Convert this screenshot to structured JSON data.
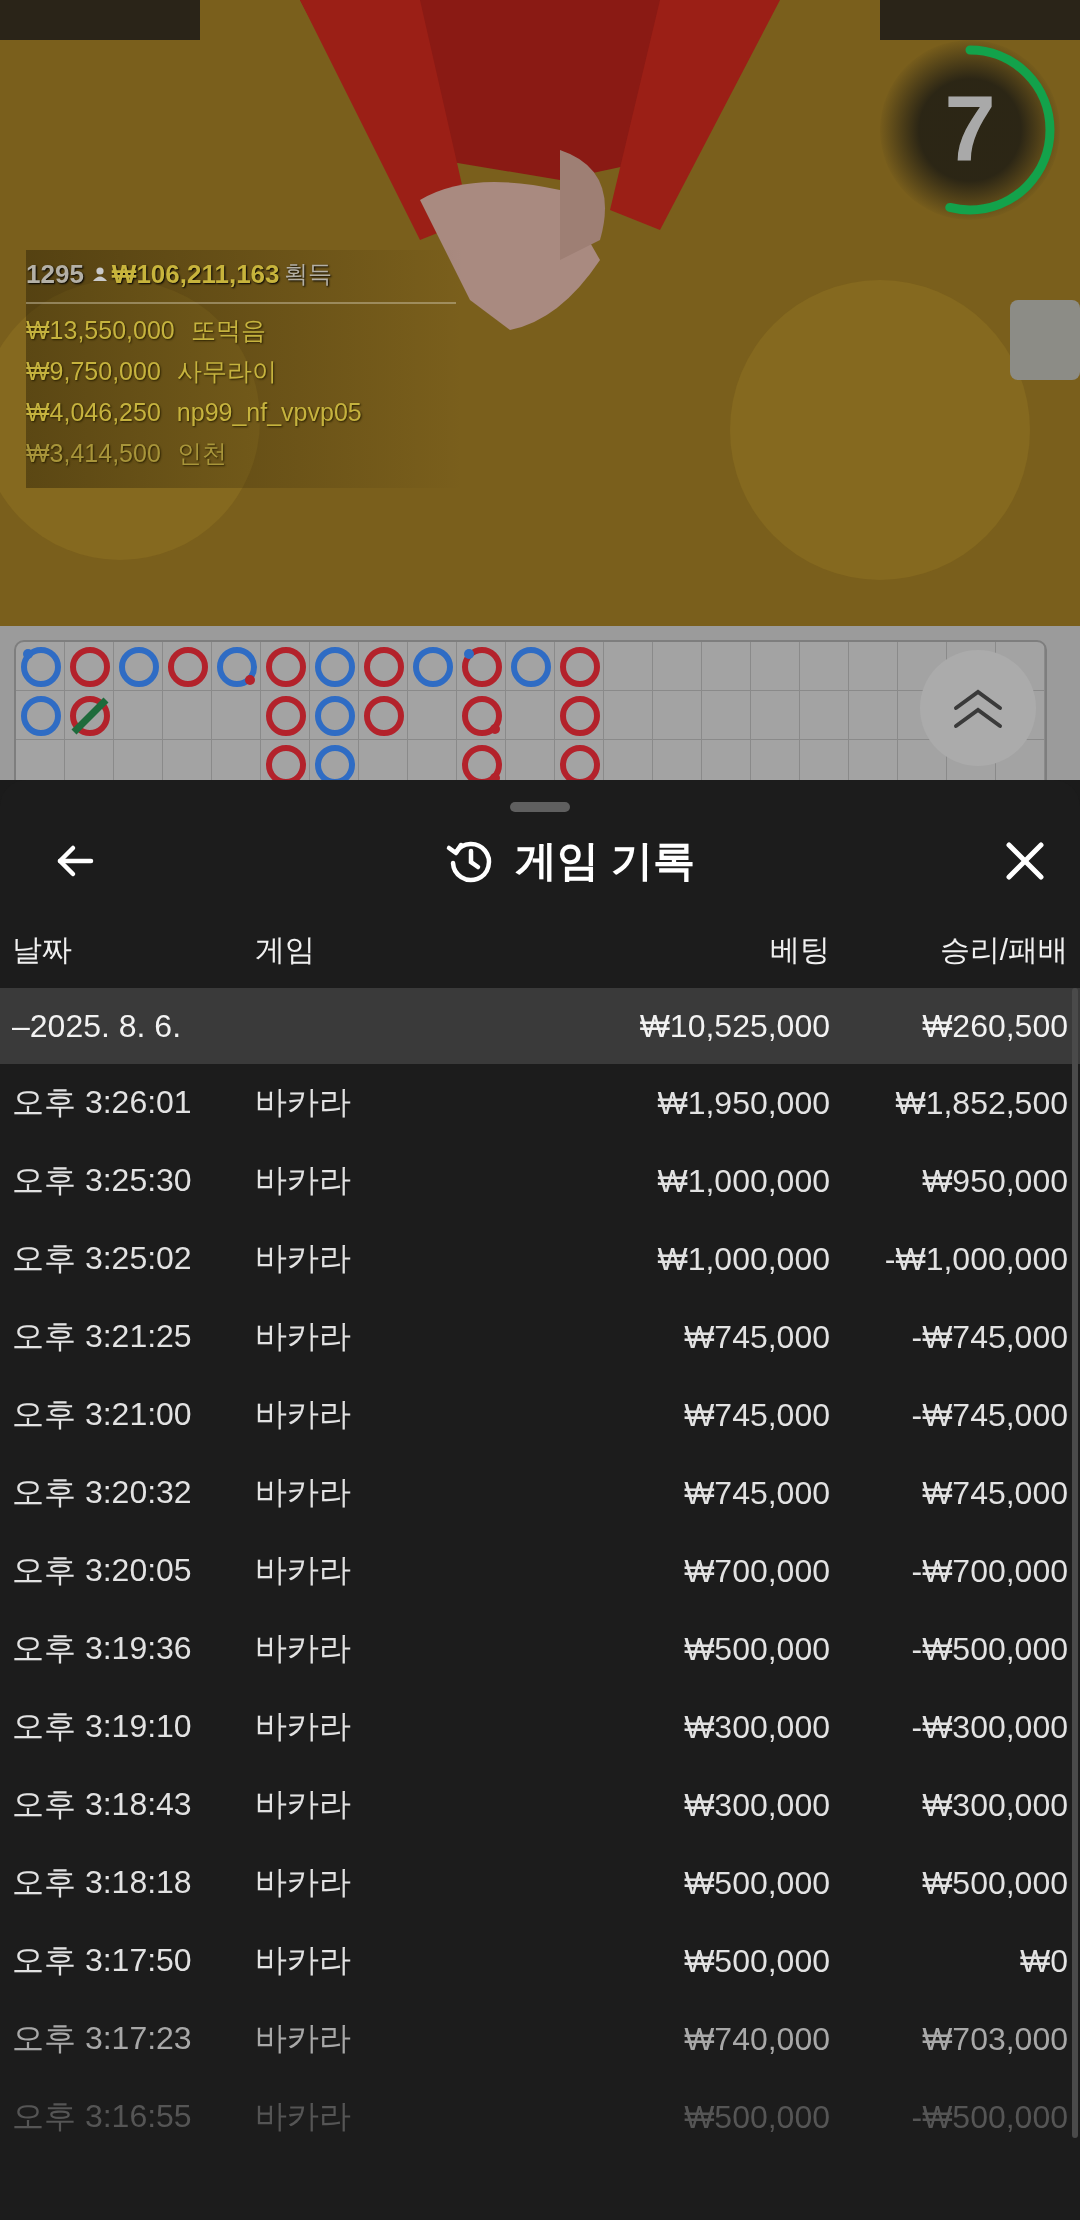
{
  "video": {
    "kind": "picture",
    "timer": {
      "count": "7",
      "level": 0.54
    },
    "stats": {
      "players": "1295",
      "total": "₩106,211,163",
      "total_label": "획득",
      "leaders": [
        {
          "amount": "₩13,550,000",
          "name": "또먹음"
        },
        {
          "amount": "₩9,750,000",
          "name": "사무라이"
        },
        {
          "amount": "₩4,046,250",
          "name": "np99_nf_vpvp05"
        },
        {
          "amount": "₩3,414,500",
          "name": "인천"
        }
      ]
    }
  },
  "roadmap": {
    "columns": [
      [
        {
          "color": "#2f6cc4",
          "player_pair": true,
          "banker_pair": false,
          "tie": false
        },
        {
          "color": "#2f6cc4",
          "player_pair": false,
          "banker_pair": false,
          "tie": false
        }
      ],
      [
        {
          "color": "#b3222b",
          "player_pair": false,
          "banker_pair": false,
          "tie": false
        },
        {
          "color": "#b3222b",
          "player_pair": false,
          "banker_pair": false,
          "tie": true
        }
      ],
      [
        {
          "color": "#2f6cc4",
          "player_pair": false,
          "banker_pair": false,
          "tie": false
        }
      ],
      [
        {
          "color": "#b3222b",
          "player_pair": false,
          "banker_pair": false,
          "tie": false
        }
      ],
      [
        {
          "color": "#2f6cc4",
          "player_pair": false,
          "banker_pair": true,
          "tie": false
        }
      ],
      [
        {
          "color": "#b3222b",
          "player_pair": false,
          "banker_pair": false,
          "tie": false
        },
        {
          "color": "#b3222b",
          "player_pair": false,
          "banker_pair": false,
          "tie": false
        },
        {
          "color": "#b3222b",
          "player_pair": false,
          "banker_pair": false,
          "tie": false
        }
      ],
      [
        {
          "color": "#2f6cc4",
          "player_pair": false,
          "banker_pair": false,
          "tie": false
        },
        {
          "color": "#2f6cc4",
          "player_pair": false,
          "banker_pair": false,
          "tie": false
        },
        {
          "color": "#2f6cc4",
          "player_pair": false,
          "banker_pair": false,
          "tie": false
        }
      ],
      [
        {
          "color": "#b3222b",
          "player_pair": false,
          "banker_pair": false,
          "tie": false
        },
        {
          "color": "#b3222b",
          "player_pair": false,
          "banker_pair": false,
          "tie": false
        }
      ],
      [
        {
          "color": "#2f6cc4",
          "player_pair": false,
          "banker_pair": false,
          "tie": false
        }
      ],
      [
        {
          "color": "#b3222b",
          "player_pair": true,
          "banker_pair": false,
          "tie": false
        },
        {
          "color": "#b3222b",
          "player_pair": false,
          "banker_pair": true,
          "tie": false
        },
        {
          "color": "#b3222b",
          "player_pair": false,
          "banker_pair": true,
          "tie": false
        }
      ],
      [
        {
          "color": "#2f6cc4",
          "player_pair": false,
          "banker_pair": false,
          "tie": false
        }
      ],
      [
        {
          "color": "#b3222b",
          "player_pair": false,
          "banker_pair": false,
          "tie": false
        },
        {
          "color": "#b3222b",
          "player_pair": false,
          "banker_pair": false,
          "tie": false
        },
        {
          "color": "#b3222b",
          "player_pair": false,
          "banker_pair": false,
          "tie": false
        }
      ]
    ]
  },
  "sheet": {
    "title": "게임 기록",
    "table": {
      "columns": [
        "날짜",
        "게임",
        "베팅",
        "승리/패배"
      ],
      "summary": {
        "date": "–2025. 8. 6.",
        "bet": "₩10,525,000",
        "result": "₩260,500"
      },
      "rows": [
        {
          "time": "오후 3:26:01",
          "game": "바카라",
          "bet": "₩1,950,000",
          "result": "₩1,852,500"
        },
        {
          "time": "오후 3:25:30",
          "game": "바카라",
          "bet": "₩1,000,000",
          "result": "₩950,000"
        },
        {
          "time": "오후 3:25:02",
          "game": "바카라",
          "bet": "₩1,000,000",
          "result": "-₩1,000,000"
        },
        {
          "time": "오후 3:21:25",
          "game": "바카라",
          "bet": "₩745,000",
          "result": "-₩745,000"
        },
        {
          "time": "오후 3:21:00",
          "game": "바카라",
          "bet": "₩745,000",
          "result": "-₩745,000"
        },
        {
          "time": "오후 3:20:32",
          "game": "바카라",
          "bet": "₩745,000",
          "result": "₩745,000"
        },
        {
          "time": "오후 3:20:05",
          "game": "바카라",
          "bet": "₩700,000",
          "result": "-₩700,000"
        },
        {
          "time": "오후 3:19:36",
          "game": "바카라",
          "bet": "₩500,000",
          "result": "-₩500,000"
        },
        {
          "time": "오후 3:19:10",
          "game": "바카라",
          "bet": "₩300,000",
          "result": "-₩300,000"
        },
        {
          "time": "오후 3:18:43",
          "game": "바카라",
          "bet": "₩300,000",
          "result": "₩300,000"
        },
        {
          "time": "오후 3:18:18",
          "game": "바카라",
          "bet": "₩500,000",
          "result": "₩500,000"
        },
        {
          "time": "오후 3:17:50",
          "game": "바카라",
          "bet": "₩500,000",
          "result": "₩0"
        },
        {
          "time": "오후 3:17:23",
          "game": "바카라",
          "bet": "₩740,000",
          "result": "₩703,000"
        },
        {
          "time": "오후 3:16:55",
          "game": "바카라",
          "bet": "₩500,000",
          "result": "-₩500,000"
        }
      ]
    }
  }
}
